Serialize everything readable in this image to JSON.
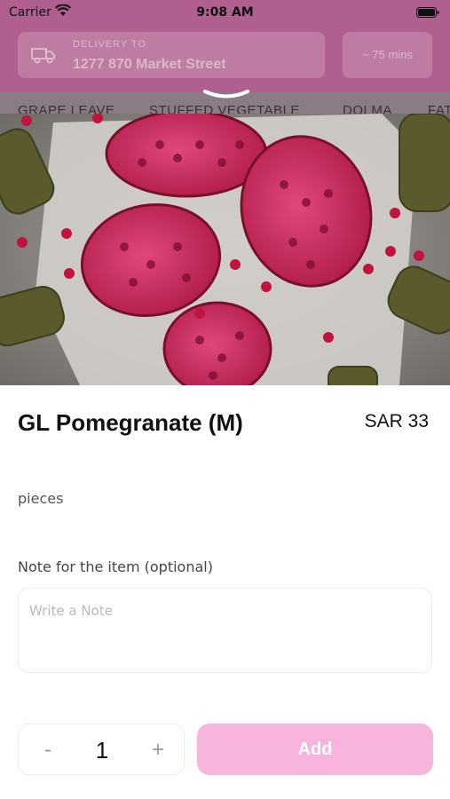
{
  "status_bar": {
    "carrier": "Carrier",
    "time": "9:08 AM"
  },
  "background": {
    "delivery_label": "DELIVERY TO",
    "delivery_address": "1277 870 Market Street",
    "eta": "~ 75 mins",
    "categories": [
      "GRAPE LEAVE",
      "STUFFED VEGETABLE",
      "DOLMA",
      "FAT"
    ]
  },
  "item": {
    "image_icon": "pomegranate-photo",
    "title": "GL Pomegranate (M)",
    "price": "SAR 33",
    "description": "pieces"
  },
  "note": {
    "label": "Note for the item (optional)",
    "placeholder": "Write a Note",
    "value": ""
  },
  "quantity": {
    "minus_label": "-",
    "value": "1",
    "plus_label": "+"
  },
  "add_button": {
    "label": "Add",
    "color": "#f7b4dc"
  },
  "colors": {
    "overlay": "#b0608f",
    "accent": "#f7b4dc"
  }
}
